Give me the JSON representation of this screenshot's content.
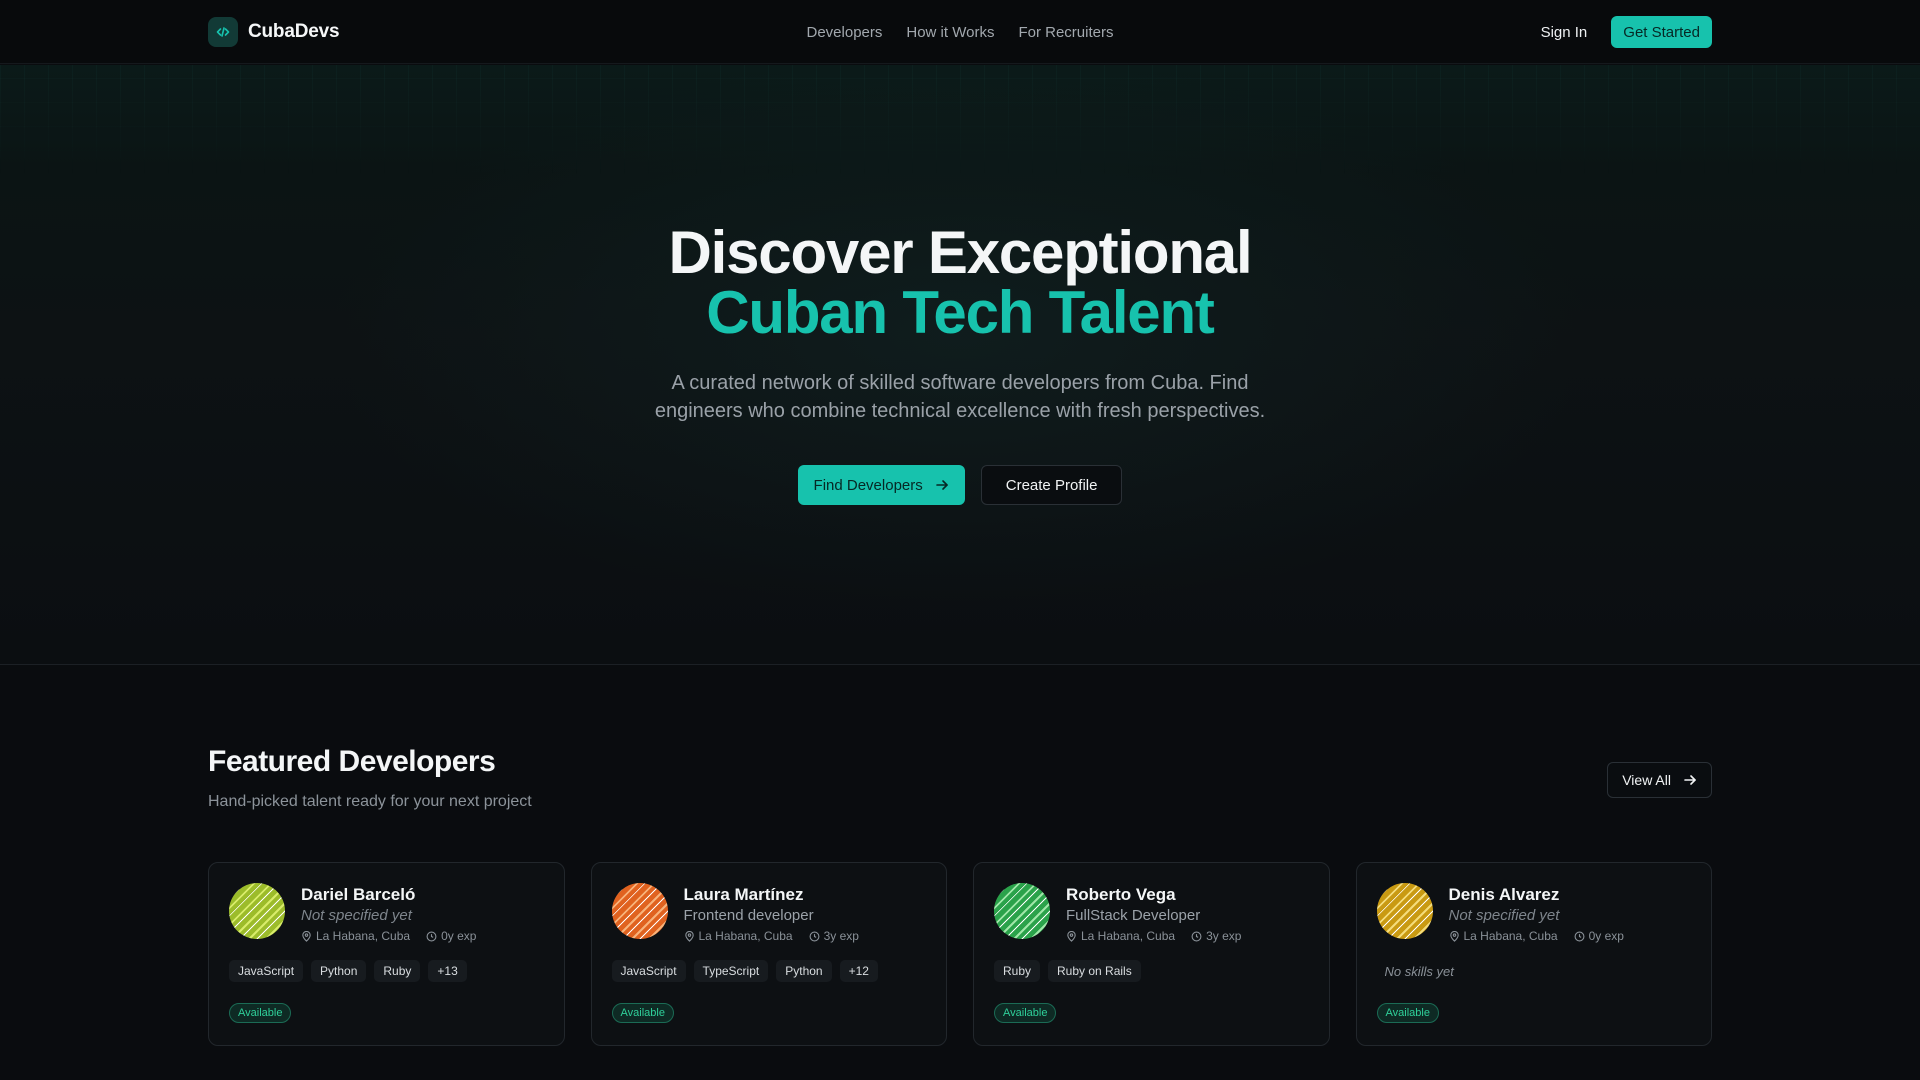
{
  "nav": {
    "brand": "CubaDevs",
    "links": [
      "Developers",
      "How it Works",
      "For Recruiters"
    ],
    "sign_in": "Sign In",
    "get_started": "Get Started"
  },
  "hero": {
    "title_line1": "Discover Exceptional",
    "title_line2": "Cuban Tech Talent",
    "subtitle_line1": "A curated network of skilled software developers from Cuba. Find",
    "subtitle_line2": "engineers who combine technical excellence with fresh perspectives.",
    "primary_cta": "Find Developers",
    "secondary_cta": "Create Profile"
  },
  "featured": {
    "title": "Featured Developers",
    "subtitle": "Hand-picked talent ready for your next project",
    "view_all": "View All",
    "developers": [
      {
        "name": "Dariel Barceló",
        "role": "Not specified yet",
        "location": "La Habana, Cuba",
        "experience": "0y exp",
        "skills": [
          "JavaScript",
          "Python",
          "Ruby",
          "+13"
        ],
        "no_skills": "",
        "status": "Available",
        "avatar_colors": [
          "#9cbc2a",
          "#d8ec6a"
        ]
      },
      {
        "name": "Laura Martínez",
        "role": "Frontend developer",
        "location": "La Habana, Cuba",
        "experience": "3y exp",
        "skills": [
          "JavaScript",
          "TypeScript",
          "Python",
          "+12"
        ],
        "no_skills": "",
        "status": "Available",
        "avatar_colors": [
          "#e0621f",
          "#f7b27a"
        ]
      },
      {
        "name": "Roberto Vega",
        "role": "FullStack Developer",
        "location": "La Habana, Cuba",
        "experience": "3y exp",
        "skills": [
          "Ruby",
          "Ruby on Rails"
        ],
        "no_skills": "",
        "status": "Available",
        "avatar_colors": [
          "#2aa24a",
          "#9fe6a8"
        ]
      },
      {
        "name": "Denis Alvarez",
        "role": "Not specified yet",
        "location": "La Habana, Cuba",
        "experience": "0y exp",
        "skills": [],
        "no_skills": "No skills yet",
        "status": "Available",
        "avatar_colors": [
          "#c99a12",
          "#f4dc7a"
        ]
      }
    ]
  },
  "colors": {
    "accent": "#17c2ad",
    "background": "#0a0c0f",
    "available": "#2fd09a"
  },
  "icons": [
    "code-icon",
    "arrow-right-icon",
    "map-pin-icon",
    "clock-icon"
  ]
}
